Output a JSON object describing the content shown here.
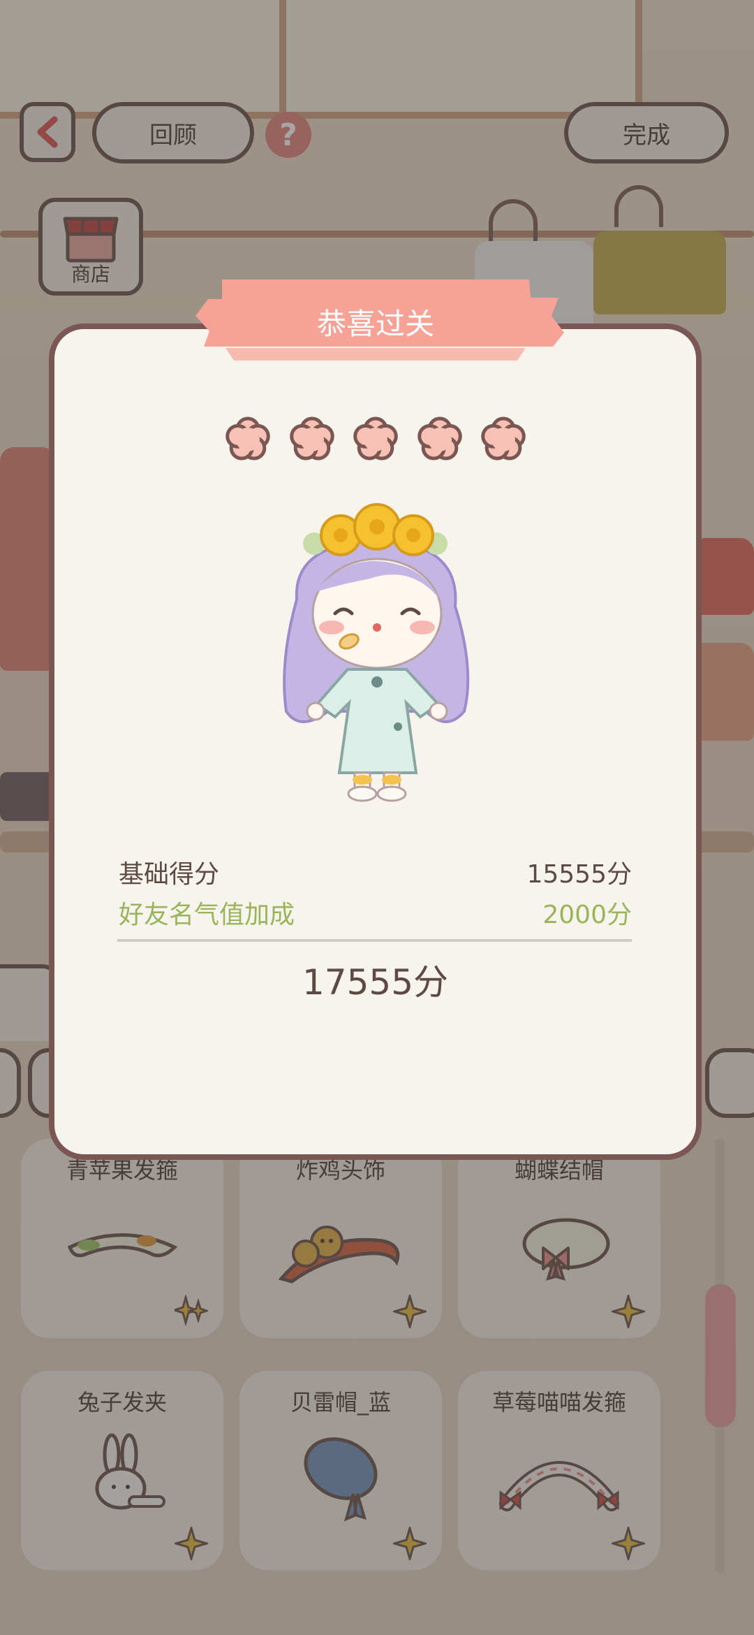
{
  "header": {
    "back_icon": "chevron-left-icon",
    "review_label": "回顾",
    "help_icon": "question-icon",
    "done_label": "完成"
  },
  "shop": {
    "label": "商店",
    "icon": "shop-awning-icon"
  },
  "items": [
    {
      "name": "青苹果发箍",
      "art": "green-apple-headband",
      "badge": "double-sparkle-icon"
    },
    {
      "name": "炸鸡头饰",
      "art": "fried-chicken-headpiece",
      "badge": "sparkle-icon"
    },
    {
      "name": "蝴蝶结帽",
      "art": "bow-hat",
      "badge": "sparkle-icon"
    },
    {
      "name": "兔子发夹",
      "art": "bunny-hairclip",
      "badge": "sparkle-icon"
    },
    {
      "name": "贝雷帽_蓝",
      "art": "blue-beret",
      "badge": "sparkle-icon"
    },
    {
      "name": "草莓喵喵发箍",
      "art": "strawberry-cat-headband",
      "badge": "sparkle-icon"
    }
  ],
  "result": {
    "title": "恭喜过关",
    "stars_earned": 5,
    "stars_total": 5,
    "base_label": "基础得分",
    "base_value": "15555分",
    "bonus_label": "好友名气值加成",
    "bonus_value": "2000分",
    "total_value": "17555分"
  },
  "colors": {
    "accent": "#f4a69a",
    "outline": "#7a5752",
    "bonus": "#98b55a",
    "star": "#f8c1b6"
  }
}
